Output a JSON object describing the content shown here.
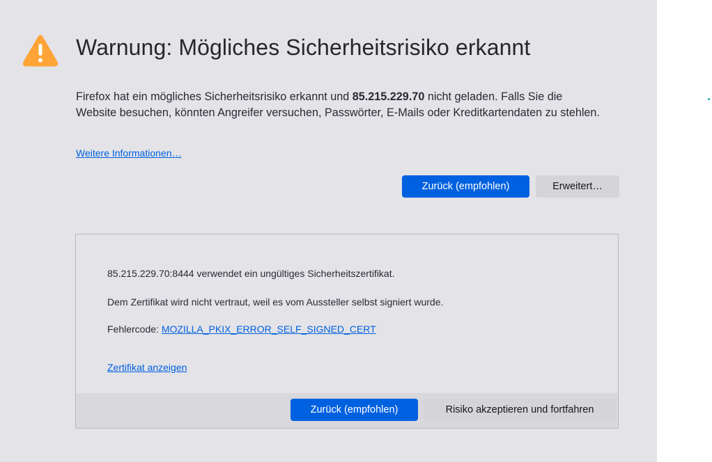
{
  "error_page": {
    "title": "Warnung: Mögliches Sicherheitsrisiko erkannt",
    "intro": {
      "part1": "Firefox hat ein mögliches Sicherheitsrisiko erkannt und ",
      "host": "85.215.229.70",
      "part2": " nicht geladen. Falls Sie die Website besuchen, könnten Angreifer versuchen, Passwörter, E-Mails oder Kreditkartendaten zu stehlen."
    },
    "more_info_link": "Weitere Informationen…",
    "back_button": "Zurück (empfohlen)",
    "advanced_button": "Erweitert…"
  },
  "advanced_panel": {
    "cert_message": "85.215.229.70:8444 verwendet ein ungültiges Sicherheitszertifikat.",
    "trust_message": "Dem Zertifikat wird nicht vertraut, weil es vom Aussteller selbst signiert wurde.",
    "error_code_label": "Fehlercode: ",
    "error_code": "MOZILLA_PKIX_ERROR_SELF_SIGNED_CERT",
    "view_cert_link": "Zertifikat anzeigen",
    "back_button": "Zurück (empfohlen)",
    "accept_button": "Risiko akzeptieren und fortfahren"
  },
  "icons": {
    "warning": "warning-triangle-icon"
  },
  "colors": {
    "background": "#e3e3e8",
    "primary_button": "#0061e0",
    "link": "#0060df",
    "warning": "#ffa436",
    "text": "#2b2a33"
  }
}
